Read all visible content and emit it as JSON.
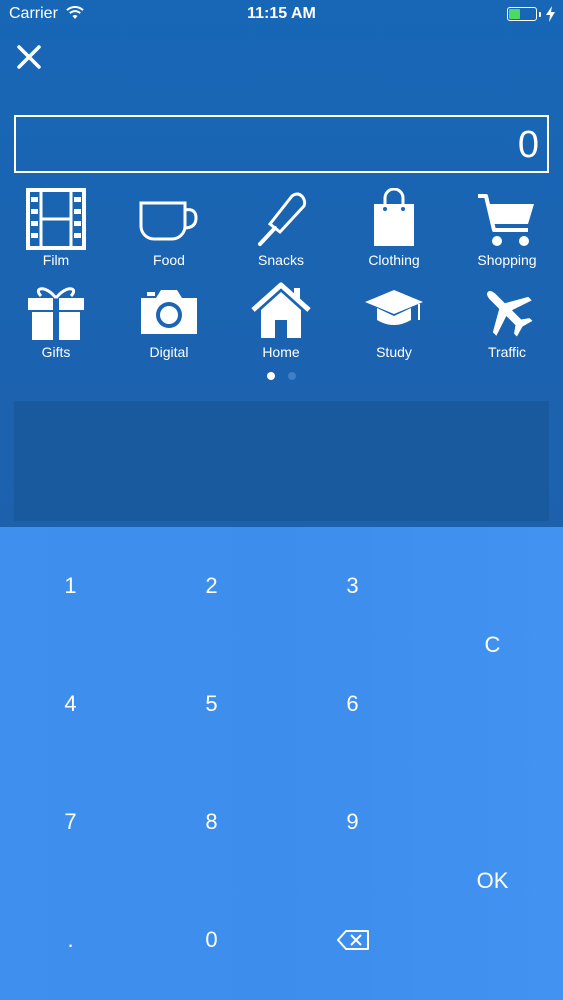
{
  "status_bar": {
    "carrier": "Carrier",
    "time": "11:15 AM",
    "battery_color": "#4cd964"
  },
  "close_icon": "close-icon",
  "amount": {
    "value": "0"
  },
  "categories": [
    {
      "label": "Film",
      "icon": "film-icon"
    },
    {
      "label": "Food",
      "icon": "cup-icon"
    },
    {
      "label": "Snacks",
      "icon": "popsicle-icon"
    },
    {
      "label": "Clothing",
      "icon": "shopping-bag-icon"
    },
    {
      "label": "Shopping",
      "icon": "cart-icon"
    },
    {
      "label": "Gifts",
      "icon": "gift-icon"
    },
    {
      "label": "Digital",
      "icon": "camera-icon"
    },
    {
      "label": "Home",
      "icon": "house-icon"
    },
    {
      "label": "Study",
      "icon": "graduation-cap-icon"
    },
    {
      "label": "Traffic",
      "icon": "airplane-icon"
    }
  ],
  "pager": {
    "pages": 2,
    "current": 1
  },
  "keypad": {
    "k1": "1",
    "k2": "2",
    "k3": "3",
    "k4": "4",
    "k5": "5",
    "k6": "6",
    "k7": "7",
    "k8": "8",
    "k9": "9",
    "kdot": ".",
    "k0": "0",
    "clear": "C",
    "ok": "OK",
    "backspace_icon": "backspace-icon"
  },
  "colors": {
    "header_bg": "#1a66b5",
    "keypad_bg": "#3f8fef",
    "note_bg": "#195a9e"
  }
}
